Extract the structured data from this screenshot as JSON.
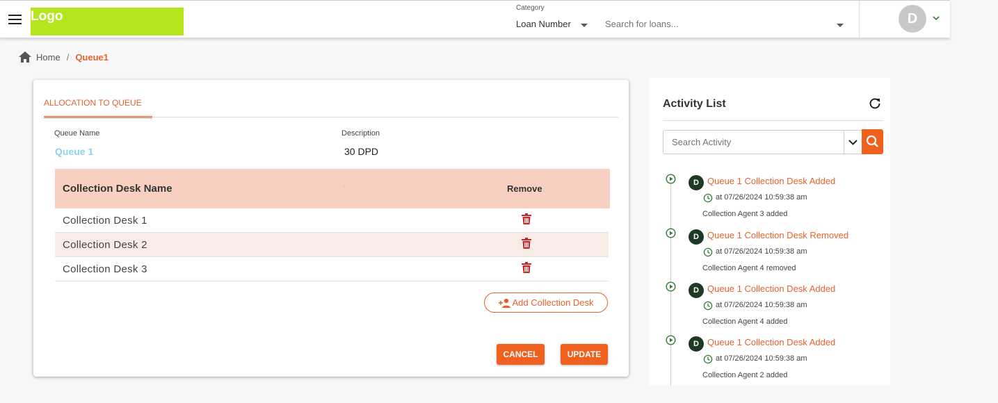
{
  "header": {
    "logo_text": "Logo",
    "category_label": "Category",
    "category_value": "Loan Number",
    "search_placeholder": "Search for loans...",
    "avatar_initial": "D"
  },
  "breadcrumb": {
    "home": "Home",
    "separator": "/",
    "current": "Queue1"
  },
  "allocation": {
    "tab_label": "ALLOCATION TO QUEUE",
    "queue_name_label": "Queue Name",
    "queue_name_value": "Queue 1",
    "description_label": "Description",
    "description_value": "30 DPD",
    "table": {
      "col_name": "Collection Desk Name",
      "col_mid": "·",
      "col_remove": "Remove",
      "rows": [
        "Collection Desk 1",
        "Collection Desk 2",
        "Collection Desk 3"
      ]
    },
    "add_button": "Add Collection Desk",
    "cancel_button": "CANCEL",
    "update_button": "UPDATE"
  },
  "activity": {
    "title": "Activity List",
    "search_placeholder": "Search Activity",
    "items": [
      {
        "initial": "D",
        "title": "Queue 1 Collection Desk Added",
        "time": "at 07/26/2024 10:59:38 am",
        "note": "Collection Agent 3 added"
      },
      {
        "initial": "D",
        "title": "Queue 1 Collection Desk Removed",
        "time": "at 07/26/2024 10:59:38 am",
        "note": "Collection Agent 4 removed"
      },
      {
        "initial": "D",
        "title": "Queue 1 Collection Desk Added",
        "time": "at 07/26/2024 10:59:38 am",
        "note": "Collection Agent 4 added"
      },
      {
        "initial": "D",
        "title": "Queue 1 Collection Desk Added",
        "time": "at 07/26/2024 10:59:38 am",
        "note": "Collection Agent 2 added"
      }
    ]
  },
  "colors": {
    "accent": "#e8612c",
    "logo_bg": "#b5e61d",
    "table_header_bg": "#f8d0c2",
    "queue_name": "#8fd0e8",
    "activity_avatar": "#1f3a24",
    "timeline_icon": "#2e7d32",
    "trash": "#c62828"
  },
  "icons": [
    "menu-icon",
    "caret-down-icon",
    "chevron-down-icon",
    "home-icon",
    "trash-icon",
    "add-person-icon",
    "refresh-icon",
    "search-icon",
    "play-circle-icon",
    "clock-icon"
  ]
}
